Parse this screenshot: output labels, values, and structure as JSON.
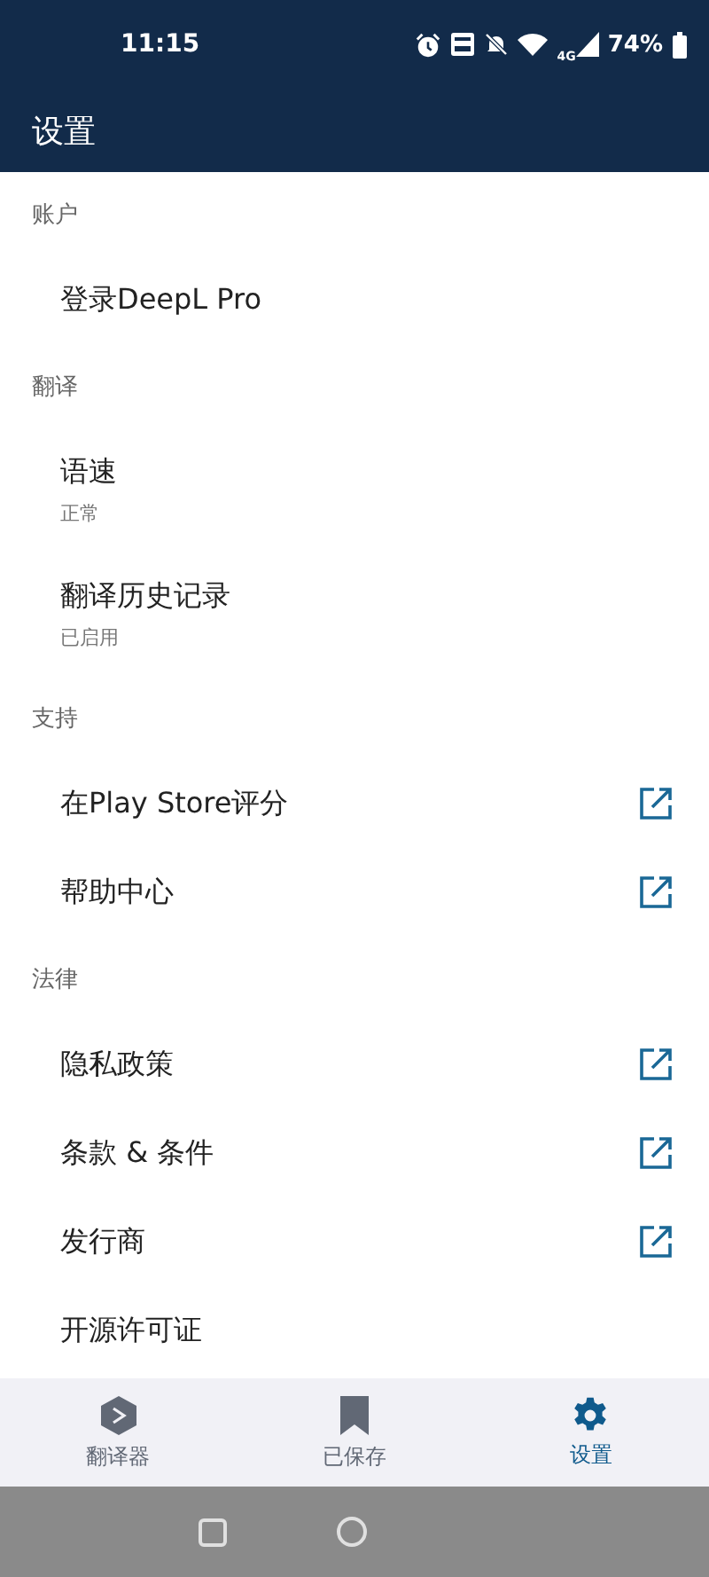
{
  "status_bar": {
    "time": "11:15",
    "network": "4G",
    "battery": "74%"
  },
  "header": {
    "title": "设置"
  },
  "sections": [
    {
      "title": "账户",
      "items": [
        {
          "label": "登录DeepL Pro",
          "external": false
        }
      ]
    },
    {
      "title": "翻译",
      "items": [
        {
          "label": "语速",
          "subtitle": "正常",
          "external": false
        },
        {
          "label": "翻译历史记录",
          "subtitle": "已启用",
          "external": false
        }
      ]
    },
    {
      "title": "支持",
      "items": [
        {
          "label": "在Play Store评分",
          "external": true
        },
        {
          "label": "帮助中心",
          "external": true
        }
      ]
    },
    {
      "title": "法律",
      "items": [
        {
          "label": "隐私政策",
          "external": true
        },
        {
          "label": "条款 & 条件",
          "external": true
        },
        {
          "label": "发行商",
          "external": true
        },
        {
          "label": "开源许可证",
          "external": false
        }
      ]
    }
  ],
  "bottom_nav": [
    {
      "kind": "translator",
      "label": "翻译器",
      "selected": false
    },
    {
      "kind": "saved",
      "label": "已保存",
      "selected": false
    },
    {
      "kind": "settings",
      "label": "设置",
      "selected": true
    }
  ]
}
